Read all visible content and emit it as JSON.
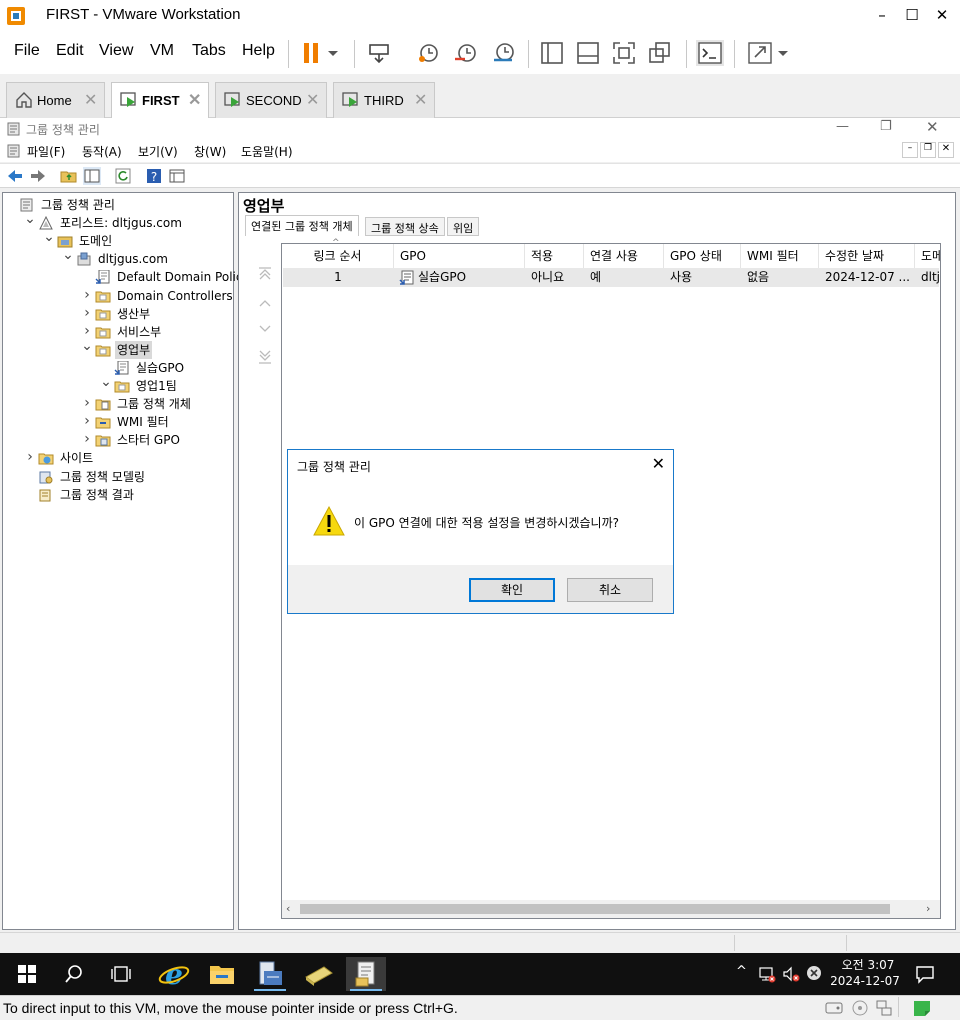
{
  "vmware": {
    "title": "FIRST - VMware Workstation",
    "menu": [
      "File",
      "Edit",
      "View",
      "VM",
      "Tabs",
      "Help"
    ],
    "tabs": [
      {
        "label": "Home"
      },
      {
        "label": "FIRST",
        "active": true
      },
      {
        "label": "SECOND"
      },
      {
        "label": "THIRD"
      }
    ],
    "status_message": "To direct input to this VM, move the mouse pointer inside or press Ctrl+G.",
    "accent": "#f07d00"
  },
  "gpmc": {
    "title": "그룹 정책 관리",
    "menu": [
      "파일(F)",
      "동작(A)",
      "보기(V)",
      "창(W)",
      "도움말(H)"
    ],
    "tree": [
      {
        "label": "그룹 정책 관리",
        "level": 0,
        "arrow": "",
        "icon": "gpmc-icon"
      },
      {
        "label": "포리스트: dltjgus.com",
        "level": 1,
        "arrow": "expanded",
        "icon": "forest-icon"
      },
      {
        "label": "도메인",
        "level": 2,
        "arrow": "expanded",
        "icon": "domains-icon"
      },
      {
        "label": "dltjgus.com",
        "level": 3,
        "arrow": "expanded",
        "icon": "domain-icon"
      },
      {
        "label": "Default Domain Policy",
        "level": 4,
        "arrow": "",
        "icon": "gpo-link-icon"
      },
      {
        "label": "Domain Controllers",
        "level": 4,
        "arrow": "collapsed",
        "icon": "ou-icon"
      },
      {
        "label": "생산부",
        "level": 4,
        "arrow": "collapsed",
        "icon": "ou-icon"
      },
      {
        "label": "서비스부",
        "level": 4,
        "arrow": "collapsed",
        "icon": "ou-icon"
      },
      {
        "label": "영업부",
        "level": 4,
        "arrow": "expanded",
        "icon": "ou-icon",
        "selected": true
      },
      {
        "label": "실습GPO",
        "level": 5,
        "arrow": "",
        "icon": "gpo-link-icon"
      },
      {
        "label": "영업1팀",
        "level": 5,
        "arrow": "expanded",
        "icon": "ou-icon"
      },
      {
        "label": "그룹 정책 개체",
        "level": 4,
        "arrow": "collapsed",
        "icon": "gpo-folder-icon"
      },
      {
        "label": "WMI 필터",
        "level": 4,
        "arrow": "collapsed",
        "icon": "wmi-folder-icon"
      },
      {
        "label": "스타터 GPO",
        "level": 4,
        "arrow": "collapsed",
        "icon": "starter-folder-icon"
      },
      {
        "label": "사이트",
        "level": 1,
        "arrow": "collapsed",
        "icon": "sites-icon"
      },
      {
        "label": "그룹 정책 모델링",
        "level": 1,
        "arrow": "",
        "icon": "modeling-icon"
      },
      {
        "label": "그룹 정책 결과",
        "level": 1,
        "arrow": "",
        "icon": "results-icon"
      }
    ],
    "pane": {
      "header": "영업부",
      "tabs": [
        "연결된 그룹 정책 개체",
        "그룹 정책 상속",
        "위임"
      ],
      "columns": [
        "링크 순서",
        "GPO",
        "적용",
        "연결 사용",
        "GPO 상태",
        "WMI 필터",
        "수정한 날짜",
        "도메"
      ],
      "rows": [
        [
          "1",
          "실습GPO",
          "아니요",
          "예",
          "사용",
          "없음",
          "2024-12-07 ...",
          "dltj"
        ]
      ]
    }
  },
  "dialog": {
    "title": "그룹 정책 관리",
    "message": "이 GPO 연결에 대한 적용 설정을 변경하시겠습니까?",
    "ok": "확인",
    "cancel": "취소"
  },
  "taskbar": {
    "time": "오전 3:07",
    "date": "2024-12-07"
  }
}
